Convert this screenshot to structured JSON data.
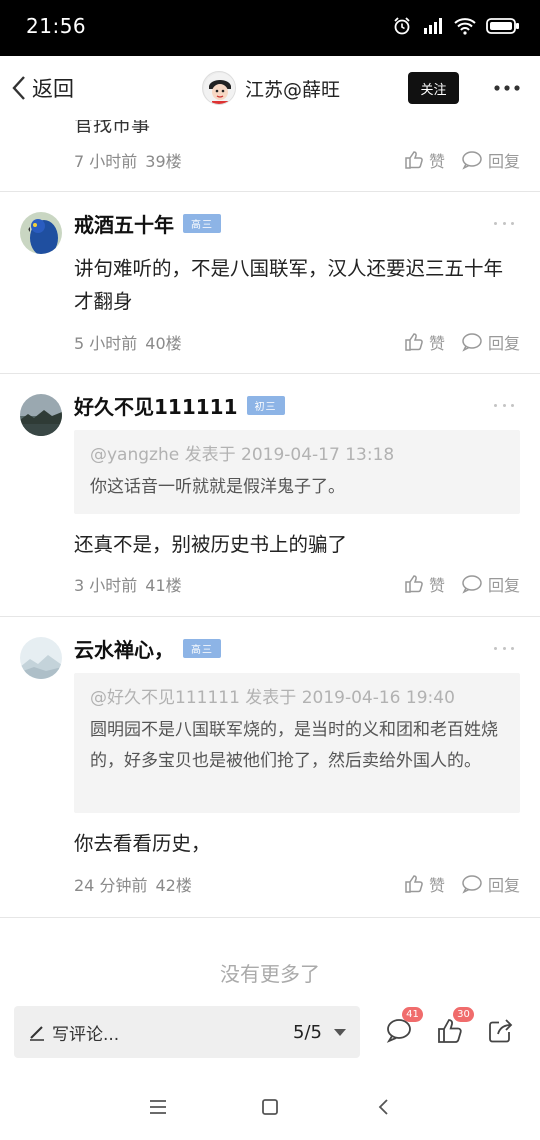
{
  "status_bar": {
    "time": "21:56"
  },
  "header": {
    "back_label": "返回",
    "user_name": "江苏@薛旺",
    "follow_label": "关注"
  },
  "partial_comment": {
    "text_fragment": "官找市事",
    "time": "7 小时前",
    "floor": "39楼",
    "like_label": "赞",
    "reply_label": "回复"
  },
  "comments": [
    {
      "username": "戒酒五十年",
      "badge": "高三",
      "text": "讲句难听的，不是八国联军，汉人还要迟三五十年才翻身",
      "time": "5 小时前",
      "floor": "40楼",
      "like_label": "赞",
      "reply_label": "回复"
    },
    {
      "username": "好久不见111111",
      "badge": "初三",
      "quote_head": "@yangzhe 发表于 2019-04-17 13:18",
      "quote_body": "你这话音一听就就是假洋鬼子了。",
      "text": "还真不是，别被历史书上的骗了",
      "time": "3 小时前",
      "floor": "41楼",
      "like_label": "赞",
      "reply_label": "回复"
    },
    {
      "username": "云水禅心，",
      "badge": "高三",
      "quote_head": "@好久不见111111 发表于 2019-04-16 19:40",
      "quote_body": "圆明园不是八国联军烧的，是当时的义和团和老百姓烧的，好多宝贝也是被他们抢了，然后卖给外国人的。",
      "text": "你去看看历史，",
      "time": "24 分钟前",
      "floor": "42楼",
      "like_label": "赞",
      "reply_label": "回复"
    }
  ],
  "no_more": "没有更多了",
  "bottom_bar": {
    "comment_placeholder": "写评论...",
    "page_indicator": "5/5",
    "comment_count": "41",
    "like_count": "30"
  },
  "colors": {
    "badge_blue": "#8db4e6",
    "count_red": "#f06c6c",
    "follow_black": "#111111"
  }
}
